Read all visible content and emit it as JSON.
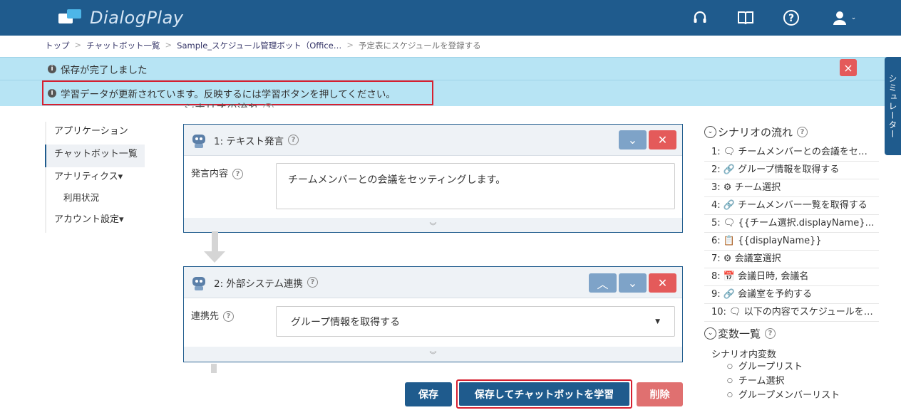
{
  "app": {
    "name": "DialogPlay"
  },
  "header": {
    "icons": [
      "headset-icon",
      "book-icon",
      "help-icon",
      "user-icon"
    ]
  },
  "breadcrumb": [
    "トップ",
    "チャットボット一覧",
    "Sample_スケジュール管理ボット（Office…",
    "予定表にスケジュールを登録する"
  ],
  "alerts": {
    "saved": "保存が完了しました",
    "update": "学習データが更新されています。反映するには学習ボタンを押してください。",
    "close": "×"
  },
  "simulator_tab": "シミュレーター",
  "nav": {
    "items": [
      "アプリケーション",
      "チャットボット一覧",
      "アナリティクス▾",
      "利用状況",
      "アカウント設定▾"
    ]
  },
  "main": {
    "section_title": "シナリオの流れ",
    "cards": [
      {
        "title": "1: テキスト発言",
        "field_label": "発言内容",
        "field_value": "チームメンバーとの会議をセッティングします。"
      },
      {
        "title": "2: 外部システム連携",
        "field_label": "連携先",
        "field_value": "グループ情報を取得する"
      }
    ],
    "buttons": {
      "save": "保存",
      "save_train": "保存してチャットボットを学習",
      "delete": "削除"
    }
  },
  "right_panel": {
    "flow_title": "シナリオの流れ",
    "flow": [
      "1: 🗨 チームメンバーとの会議をセ…",
      "2: 🔗 グループ情報を取得する",
      "3: ⚙ チーム選択",
      "4: 🔗 チームメンバー一覧を取得する",
      "5: 🗨 {{チーム選択.displayName}…",
      "6: 📋 {{displayName}}",
      "7: ⚙ 会議室選択",
      "8: 📅 会議日時, 会議名",
      "9: 🔗 会議室を予約する",
      "10: 🗨 以下の内容でスケジュールを…"
    ],
    "vars_title": "変数一覧",
    "vars_sub": "シナリオ内変数",
    "vars": [
      "グループリスト",
      "チーム選択",
      "グループメンバーリスト"
    ]
  },
  "colors": {
    "brand": "#1f5b8d",
    "alert_bg": "#b7e4f4",
    "danger": "#e45a5a",
    "highlight": "#d62030"
  }
}
